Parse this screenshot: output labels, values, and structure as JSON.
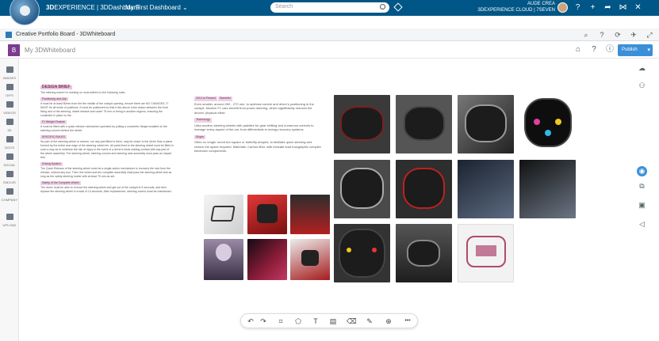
{
  "topbar": {
    "brand_prefix": "3D",
    "brand_main": "EXPERIENCE | 3DDashboard",
    "dashboard_name": "My First Dashboard",
    "dashboard_chevron": "⌄",
    "search_placeholder": "Search",
    "user_name": "AUDE CREA",
    "user_org": "3DEXPERIENCE CLOUD | 7SEVEN",
    "icons": [
      "help-icon",
      "add-icon",
      "share-icon",
      "connect-icon",
      "tools-icon"
    ]
  },
  "widget": {
    "title": "Creative Portfolio Board - 3DWhiteboard"
  },
  "app": {
    "logo_text": "B",
    "name": "My 3DWhiteboard",
    "publish_label": "Publish"
  },
  "leftbar": {
    "items": [
      {
        "label": "IMAGES"
      },
      {
        "label": "GIFS"
      },
      {
        "label": "VIDEOS"
      },
      {
        "label": "3D"
      },
      {
        "label": "DOCS"
      },
      {
        "label": "SOCIAL"
      },
      {
        "label": "EMOJIS"
      },
      {
        "label": "COMPANY"
      },
      {
        "label": "UPLOAD"
      }
    ]
  },
  "board": {
    "design_brief_title": "DESIGN BRIEF",
    "design_brief_intro": "The steering wheel I'm working on must adhere to the following rules:",
    "sections": [
      {
        "heading": "Positioning and Use",
        "text": "It must be at least 50mm from the the middle of the cockpit opening, ensure there are NO CHANGES. IT MUST be all mode of positions. It must be positioned so that it lies above a line drawn between the front fixing and of the steering, wheel release and under 75 mm or being in another regions, ensuring the constraint in place so the."
      },
      {
        "heading": "F1 Weight Feature",
        "text": "It must be fitted with a quick release mechanism operated by pulling a concentric flange installed on the steering column behind the wheel."
      },
      {
        "heading": "SPECIFIC RULES",
        "text": "No part of the steering wheel or column, nor any part fitted to them, may be closer to the driver than a plane formed by the entire rear edge of the steering wheel rim. All parts fixed to the steering wheel must be fitted in such a way as to minimize the risk of injury in the event of a driver's head making contact with any part of the wheel assembly. The steering wheel, steering column and steering rack assembly must pass an impact test."
      },
      {
        "heading": "Driving System",
        "text": "The Quick Release of the steering wheel must be a single-action mechanism to recovery the lock from the release, without any tool. Then, the wheel and the complete assembly shall pass the steering wheel test as long as the safety steering holder with at least 75 mm as set."
      },
      {
        "heading": "Safety of the Complete Wheel",
        "text": "The driver must be able to remove the steering wheel and get out of the cockpit in 5 seconds, and then replace the steering wheel in a total of 10 seconds. After replacement, steering control must be maintained."
      }
    ],
    "history_title": "2010 to Present",
    "history": [
      {
        "heading": "Diameter",
        "text": "Even smaller, around 260 - 270 mm, to optimize control and driver's positioning in the cockpit. Modern F1 cars benefit from power steering, which significantly reduces the drivers' physical effort."
      },
      {
        "heading": "Technology",
        "text": "Ultra-modern steering wheels with paddles for gear shifting and numerous controls to manage every aspect of the car, from differentials to energy recovery systems."
      },
      {
        "heading": "Shape",
        "text": "Often no longer round but square or butterfly-shaped, to facilitate quick steering and reduce the space required. Materials: Carbon fiber, with intricate lead holographic complex electronic components."
      }
    ]
  },
  "bottom_toolbar": {
    "items": [
      "undo-icon",
      "redo-icon",
      "frame-icon",
      "shape-icon",
      "text-icon",
      "note-icon",
      "eraser-icon",
      "pen-icon",
      "zoom-icon",
      "more-icon"
    ],
    "glyphs": [
      "↶",
      "↷",
      "⌗",
      "⬠",
      "T",
      "▤",
      "⌫",
      "✎",
      "⊕",
      "•••"
    ]
  }
}
